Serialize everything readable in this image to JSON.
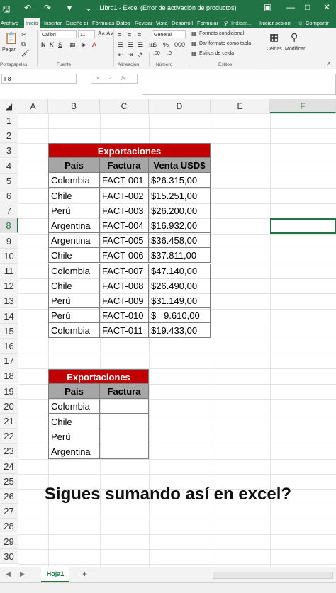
{
  "window": {
    "title": "Libro1 - Excel (Error de activación de productos)"
  },
  "tabs": [
    "Archivo",
    "Inicio",
    "Insertar",
    "Diseño di",
    "Fórmulas",
    "Datos",
    "Revisar",
    "Vista",
    "Desarroll",
    "Formular",
    "Indicar...",
    "Iniciar sesión",
    "Compartir"
  ],
  "ribbon": {
    "paste_label": "Pegar",
    "font_name": "Calibri",
    "font_size": "11",
    "number_format": "General",
    "cond_format": "Formato condicional",
    "table_format": "Dar formato como tabla",
    "cell_styles": "Estilos de celda",
    "cells_label": "Celdas",
    "modify_label": "Modificar",
    "groups": {
      "clipboard": "Portapapeles",
      "font": "Fuente",
      "alignment": "Alineación",
      "number": "Número",
      "styles": "Estilos"
    }
  },
  "formula_bar": {
    "name_box": "F8",
    "fx": "fx"
  },
  "columns": [
    "A",
    "B",
    "C",
    "D",
    "E",
    "F"
  ],
  "rows": [
    "1",
    "2",
    "3",
    "4",
    "5",
    "6",
    "7",
    "8",
    "9",
    "10",
    "11",
    "12",
    "13",
    "14",
    "15",
    "16",
    "17",
    "18",
    "19",
    "20",
    "21",
    "22",
    "23",
    "24",
    "25",
    "26",
    "27",
    "28",
    "29",
    "30"
  ],
  "table1": {
    "title": "Exportaciones",
    "headers": [
      "Pais",
      "Factura",
      "Venta USD$"
    ],
    "rows": [
      [
        "Colombia",
        "FACT-001",
        "$26.315,00"
      ],
      [
        "Chile",
        "FACT-002",
        "$15.251,00"
      ],
      [
        "Perú",
        "FACT-003",
        "$26.200,00"
      ],
      [
        "Argentina",
        "FACT-004",
        "$16.932,00"
      ],
      [
        "Argentina",
        "FACT-005",
        "$36.458,00"
      ],
      [
        "Chile",
        "FACT-006",
        "$37.811,00"
      ],
      [
        "Colombia",
        "FACT-007",
        "$47.140,00"
      ],
      [
        "Chile",
        "FACT-008",
        "$26.490,00"
      ],
      [
        "Perú",
        "FACT-009",
        "$31.149,00"
      ],
      [
        "Perú",
        "FACT-010",
        "$   9.610,00"
      ],
      [
        "Colombia",
        "FACT-011",
        "$19.433,00"
      ]
    ]
  },
  "table2": {
    "title": "Exportaciones",
    "headers": [
      "Pais",
      "Factura"
    ],
    "rows": [
      [
        "Colombia",
        ""
      ],
      [
        "Chile",
        ""
      ],
      [
        "Perú",
        ""
      ],
      [
        "Argentina",
        ""
      ]
    ]
  },
  "caption": "Sigues sumando así en excel?",
  "sheet": {
    "tab": "Hoja1",
    "add": "+"
  },
  "colors": {
    "excel_green": "#217346",
    "header_red": "#c00000",
    "header_gray": "#a6a6a6"
  }
}
